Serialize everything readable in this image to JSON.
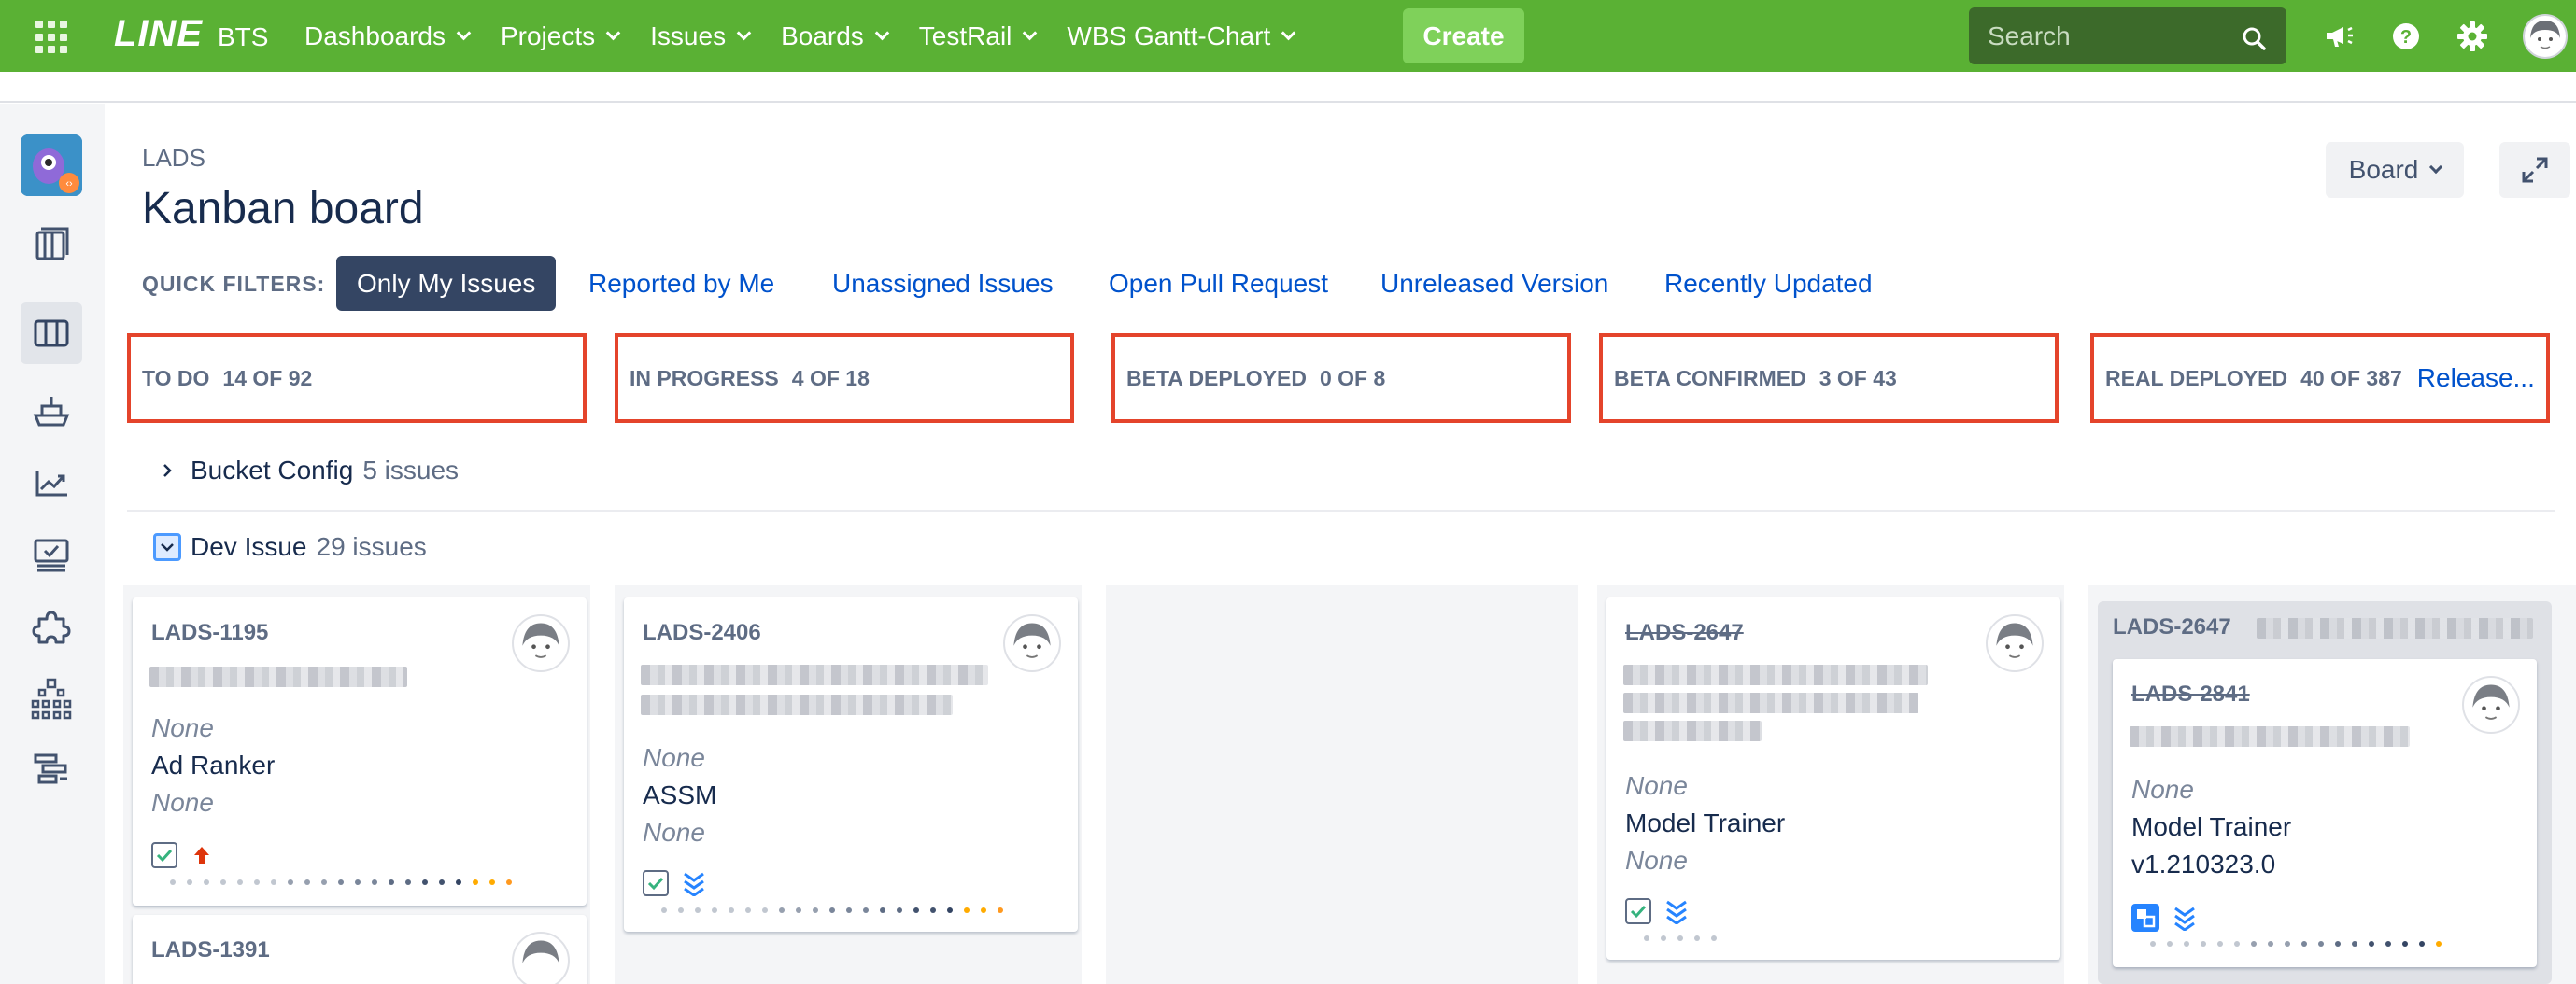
{
  "topnav": {
    "logo": "LINE",
    "product": "BTS",
    "items": [
      {
        "label": "Dashboards",
        "dropdown": true
      },
      {
        "label": "Projects",
        "dropdown": true
      },
      {
        "label": "Issues",
        "dropdown": true
      },
      {
        "label": "Boards",
        "dropdown": true
      },
      {
        "label": "TestRail",
        "dropdown": true
      },
      {
        "label": "WBS Gantt-Chart",
        "dropdown": true
      }
    ],
    "create_label": "Create",
    "search_placeholder": "Search",
    "icons": [
      "app-switcher-icon",
      "search-icon",
      "megaphone-icon",
      "help-icon",
      "settings-gear-icon",
      "user-avatar"
    ]
  },
  "sidebar": {
    "icons": [
      "project-avatar",
      "backlog-icon",
      "board-icon",
      "releases-icon",
      "reports-icon",
      "tests-icon",
      "add-ons-icon",
      "components-icon",
      "gantt-icon"
    ]
  },
  "header": {
    "breadcrumb": "LADS",
    "title": "Kanban board",
    "board_button": "Board"
  },
  "quick_filters": {
    "label": "QUICK FILTERS:",
    "items": [
      {
        "label": "Only My Issues",
        "active": true
      },
      {
        "label": "Reported by Me",
        "active": false
      },
      {
        "label": "Unassigned Issues",
        "active": false
      },
      {
        "label": "Open Pull Request",
        "active": false
      },
      {
        "label": "Unreleased Version",
        "active": false
      },
      {
        "label": "Recently Updated",
        "active": false
      }
    ]
  },
  "columns": [
    {
      "name": "TO DO",
      "count": "14 OF 92"
    },
    {
      "name": "IN PROGRESS",
      "count": "4 OF 18"
    },
    {
      "name": "BETA DEPLOYED",
      "count": "0 OF 8"
    },
    {
      "name": "BETA CONFIRMED",
      "count": "3 OF 43"
    },
    {
      "name": "REAL DEPLOYED",
      "count": "40 OF 387",
      "action": "Release..."
    }
  ],
  "swimlanes": [
    {
      "name": "Bucket Config",
      "count": "5 issues",
      "expanded": false
    },
    {
      "name": "Dev Issue",
      "count": "29 issues",
      "expanded": true
    }
  ],
  "cards": {
    "todo_1": {
      "key": "LADS-1195",
      "field1": "None",
      "component": "Ad Ranker",
      "field2": "None",
      "priority": "high-priority-arrow-icon"
    },
    "todo_2": {
      "key": "LADS-1391"
    },
    "inprogress_1": {
      "key": "LADS-2406",
      "field1": "None",
      "component": "ASSM",
      "field2": "None",
      "priority": "lowest-priority-icon"
    },
    "betaconfirmed_1": {
      "key": "LADS-2647",
      "field1": "None",
      "component": "Model Trainer",
      "field2": "None",
      "priority": "lowest-priority-icon"
    },
    "realdeployed_parent": {
      "key": "LADS-2647"
    },
    "realdeployed_1": {
      "key": "LADS-2841",
      "field1": "None",
      "component": "Model Trainer",
      "version": "v1.210323.0",
      "priority": "lowest-priority-icon"
    }
  },
  "colors": {
    "topnav": "#5ab134",
    "create": "#7fd15a",
    "column_highlight": "#e4442b",
    "link": "#0052cc",
    "active_filter": "#344563"
  }
}
